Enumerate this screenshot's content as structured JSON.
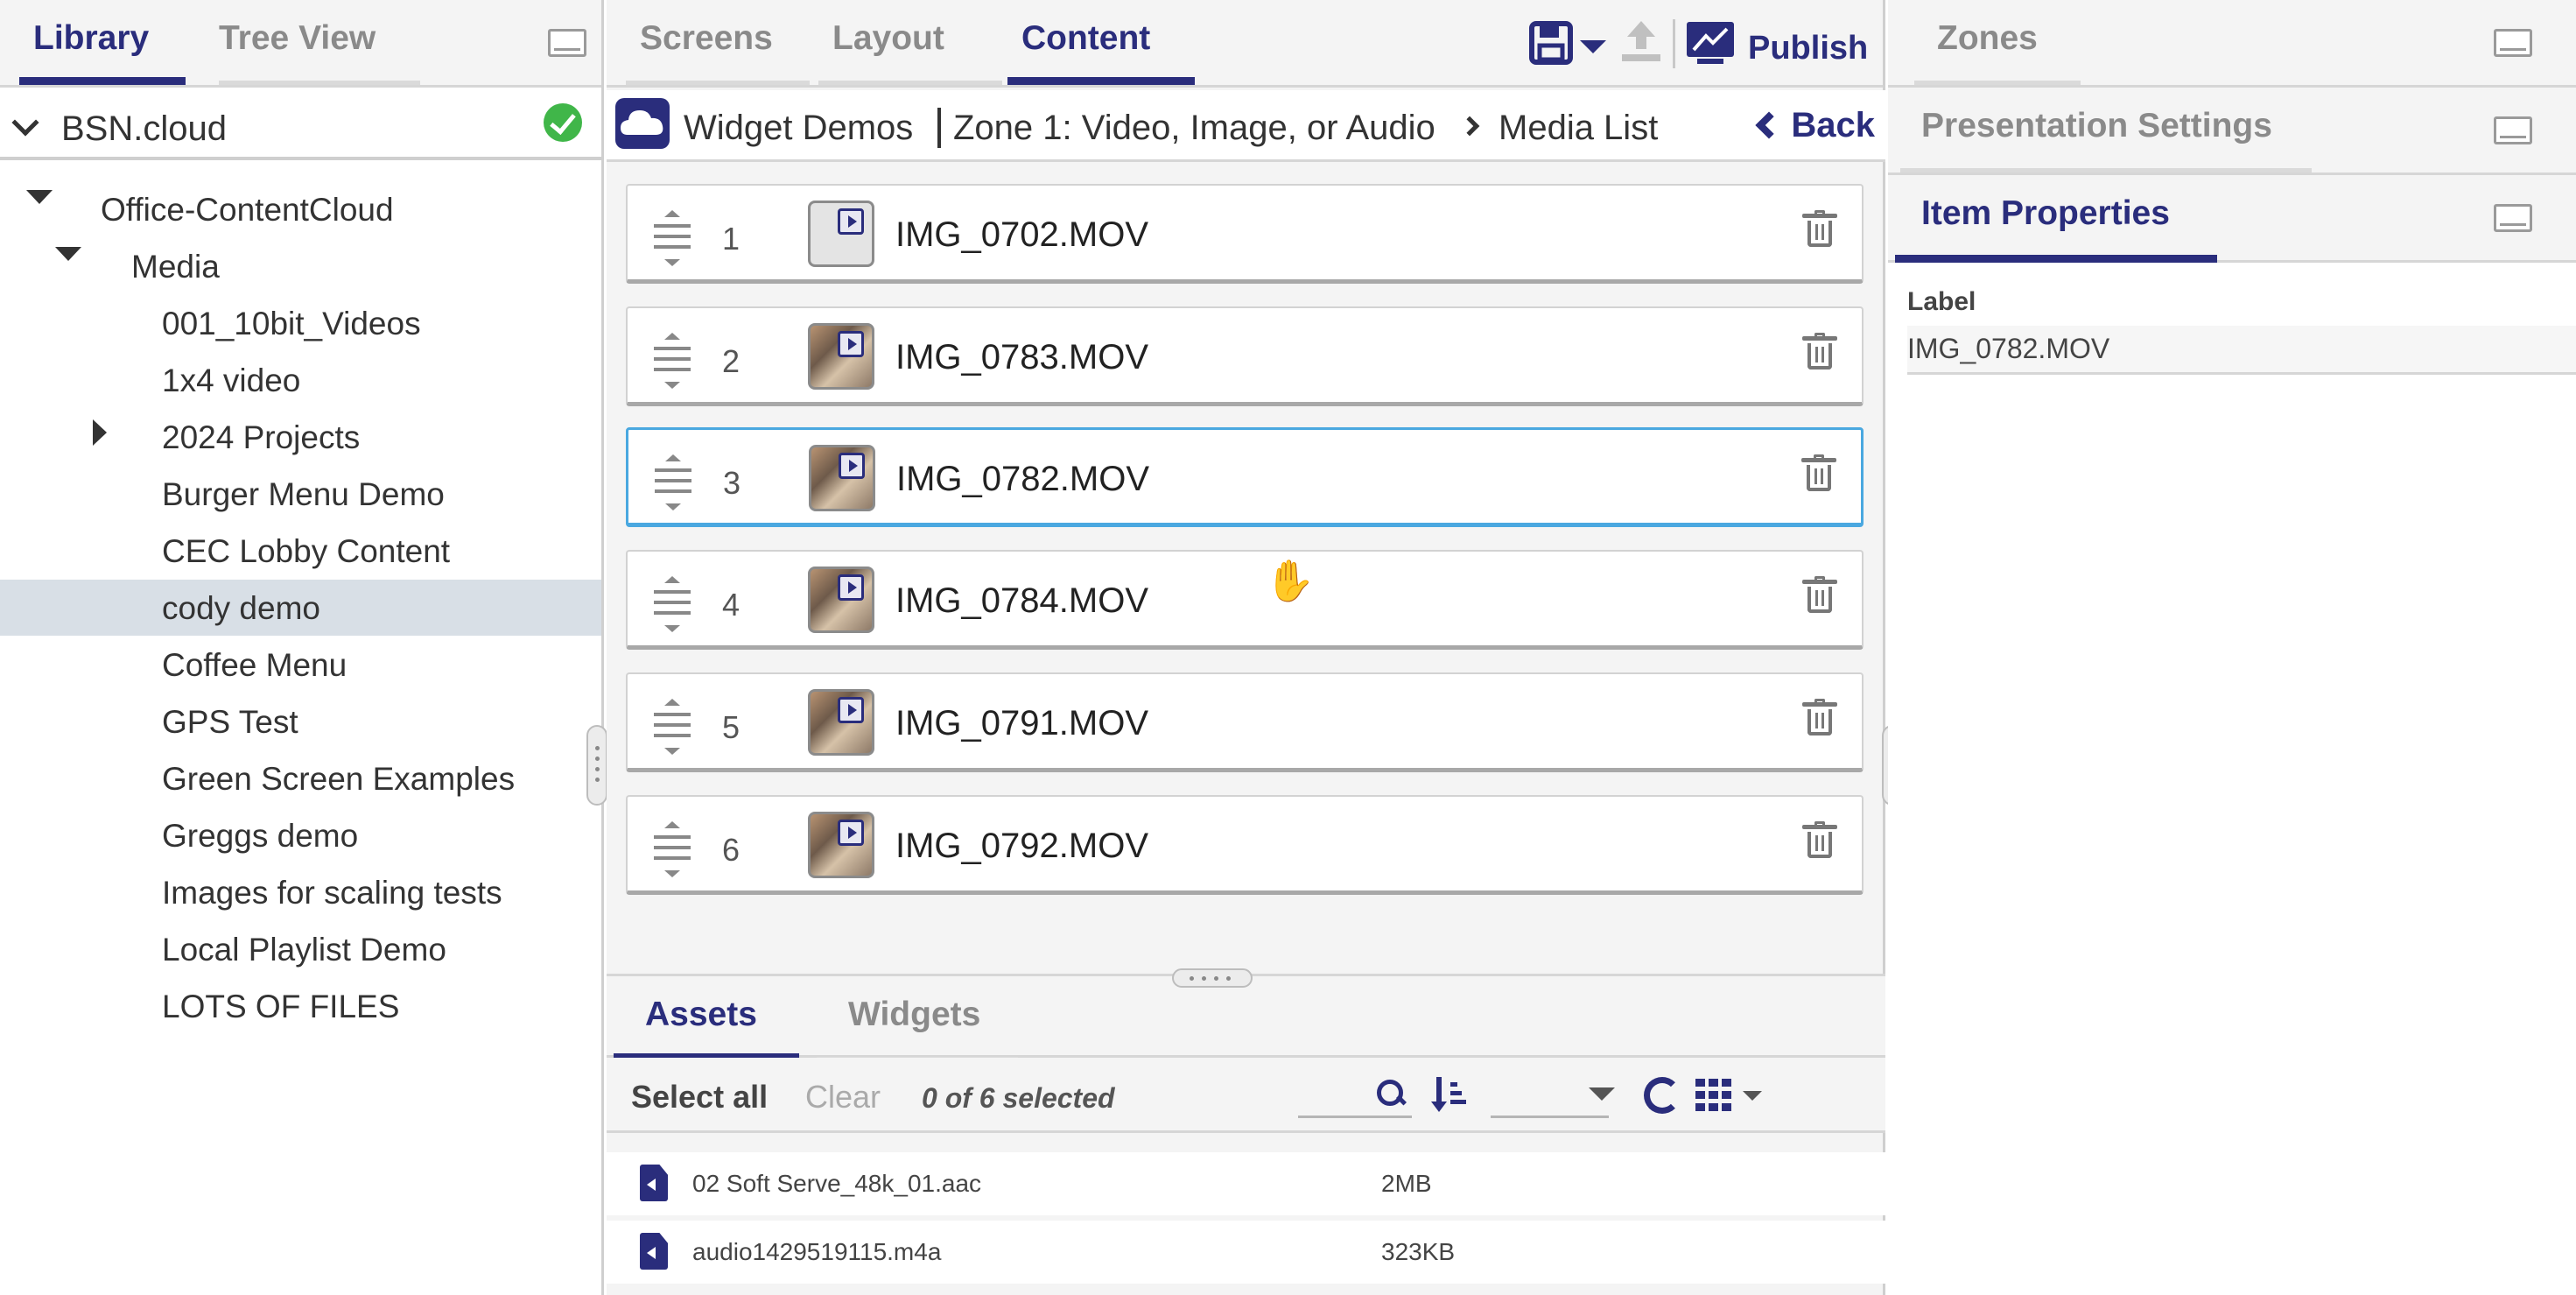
{
  "left_panel": {
    "tabs": [
      {
        "label": "Library",
        "active": true
      },
      {
        "label": "Tree View",
        "active": false
      }
    ],
    "account": {
      "label": "BSN.cloud",
      "status": "connected"
    },
    "tree": [
      {
        "label": "Office-ContentCloud",
        "expanded": true
      },
      {
        "label": "Media",
        "expanded": true
      },
      {
        "label": "001_10bit_Videos"
      },
      {
        "label": "1x4 video"
      },
      {
        "label": "2024 Projects",
        "expandable": true
      },
      {
        "label": "Burger Menu Demo"
      },
      {
        "label": "CEC Lobby Content"
      },
      {
        "label": "cody demo",
        "selected": true
      },
      {
        "label": "Coffee Menu"
      },
      {
        "label": "GPS Test"
      },
      {
        "label": "Green Screen Examples"
      },
      {
        "label": "Greggs demo"
      },
      {
        "label": "Images for scaling tests"
      },
      {
        "label": "Local Playlist Demo"
      },
      {
        "label": "LOTS OF FILES"
      }
    ]
  },
  "center_panel": {
    "tabs": [
      {
        "label": "Screens",
        "active": false
      },
      {
        "label": "Layout",
        "active": false
      },
      {
        "label": "Content",
        "active": true
      }
    ],
    "toolbar": {
      "publish_label": "Publish"
    },
    "breadcrumb": {
      "presentation": "Widget Demos",
      "zone": "Zone 1: Video, Image, or Audio",
      "page": "Media List",
      "back_label": "Back"
    },
    "media_list": [
      {
        "index": "1",
        "name": "IMG_0702.MOV",
        "thumbnail": "generic-video-icon"
      },
      {
        "index": "2",
        "name": "IMG_0783.MOV",
        "thumbnail": "video-frame"
      },
      {
        "index": "3",
        "name": "IMG_0782.MOV",
        "thumbnail": "video-frame",
        "selected": true
      },
      {
        "index": "4",
        "name": "IMG_0784.MOV",
        "thumbnail": "video-frame"
      },
      {
        "index": "5",
        "name": "IMG_0791.MOV",
        "thumbnail": "video-frame"
      },
      {
        "index": "6",
        "name": "IMG_0792.MOV",
        "thumbnail": "video-frame"
      }
    ],
    "assets": {
      "tabs": [
        {
          "label": "Assets",
          "active": true
        },
        {
          "label": "Widgets",
          "active": false
        }
      ],
      "select_all_label": "Select all",
      "clear_label": "Clear",
      "selection_status": "0 of 6 selected",
      "files": [
        {
          "name": "02 Soft Serve_48k_01.aac",
          "size": "2MB",
          "icon": "audio-file-icon"
        },
        {
          "name": "audio1429519115.m4a",
          "size": "323KB",
          "icon": "audio-file-icon"
        }
      ]
    }
  },
  "right_panel": {
    "sections": [
      {
        "label": "Zones",
        "active": false
      },
      {
        "label": "Presentation Settings",
        "active": false
      },
      {
        "label": "Item Properties",
        "active": true
      }
    ],
    "item_properties": {
      "label_field_name": "Label",
      "label_value": "IMG_0782.MOV"
    }
  },
  "colors": {
    "accent": "#2a2d7c",
    "selection_border": "#4aa8e0",
    "status_ok": "#40b649",
    "tree_selection": "#d8dfe6"
  }
}
